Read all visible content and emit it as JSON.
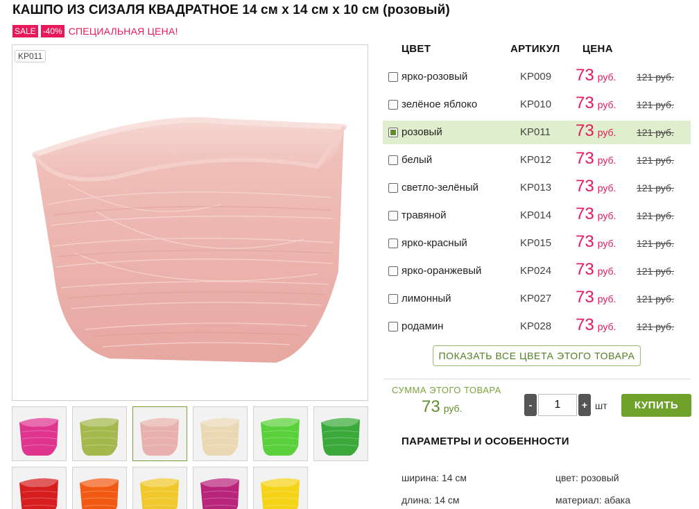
{
  "product": {
    "title": "КАШПО ИЗ СИЗАЛЯ КВАДРАТНОЕ 14 см x 14 см x 10 см (розовый)",
    "sale_badge": "SALE",
    "discount_badge": "-40%",
    "special_price_text": "СПЕЦИАЛЬНАЯ ЦЕНА!",
    "photo_sku": "KP011",
    "brand_color": "#e8195a",
    "accent_color": "#6fa12b"
  },
  "thumbnails": [
    {
      "color": "#e0358f"
    },
    {
      "color": "#a4b84d"
    },
    {
      "color": "#e8b1ad"
    },
    {
      "color": "#ead8b4"
    },
    {
      "color": "#5ad03a"
    },
    {
      "color": "#3aa93a"
    },
    {
      "color": "#d61e1e"
    },
    {
      "color": "#f25a14"
    },
    {
      "color": "#f0c82d"
    },
    {
      "color": "#b8257a"
    },
    {
      "color": "#f5d317"
    }
  ],
  "colors_table": {
    "headers": {
      "color": "ЦВЕТ",
      "sku": "АРТИКУЛ",
      "price": "ЦЕНА"
    },
    "rows": [
      {
        "name": "ярко-розовый",
        "sku": "KP009",
        "price": "73",
        "unit": "руб.",
        "old_price": "121 руб.",
        "selected": false
      },
      {
        "name": "зелёное яблоко",
        "sku": "KP010",
        "price": "73",
        "unit": "руб.",
        "old_price": "121 руб.",
        "selected": false
      },
      {
        "name": "розовый",
        "sku": "KP011",
        "price": "73",
        "unit": "руб.",
        "old_price": "121 руб.",
        "selected": true
      },
      {
        "name": "белый",
        "sku": "KP012",
        "price": "73",
        "unit": "руб.",
        "old_price": "121 руб.",
        "selected": false
      },
      {
        "name": "светло-зелёный",
        "sku": "KP013",
        "price": "73",
        "unit": "руб.",
        "old_price": "121 руб.",
        "selected": false
      },
      {
        "name": "травяной",
        "sku": "KP014",
        "price": "73",
        "unit": "руб.",
        "old_price": "121 руб.",
        "selected": false
      },
      {
        "name": "ярко-красный",
        "sku": "KP015",
        "price": "73",
        "unit": "руб.",
        "old_price": "121 руб.",
        "selected": false
      },
      {
        "name": "ярко-оранжевый",
        "sku": "KP024",
        "price": "73",
        "unit": "руб.",
        "old_price": "121 руб.",
        "selected": false
      },
      {
        "name": "лимонный",
        "sku": "KP027",
        "price": "73",
        "unit": "руб.",
        "old_price": "121 руб.",
        "selected": false
      },
      {
        "name": "родамин",
        "sku": "KP028",
        "price": "73",
        "unit": "руб.",
        "old_price": "121 руб.",
        "selected": false
      }
    ],
    "show_all_button": "ПОКАЗАТЬ ВСЕ ЦВЕТА ЭТОГО ТОВАРА"
  },
  "order": {
    "sum_label": "СУММА ЭТОГО ТОВАРА",
    "sum_value": "73",
    "sum_unit": "руб.",
    "minus": "-",
    "plus": "+",
    "quantity": "1",
    "quantity_unit": "шт",
    "buy_button": "КУПИТЬ"
  },
  "params": {
    "title": "ПАРАМЕТРЫ И ОСОБЕННОСТИ",
    "width": "ширина: 14 см",
    "length": "длина: 14 см",
    "color": "цвет: розовый",
    "material": "материал: абака"
  }
}
